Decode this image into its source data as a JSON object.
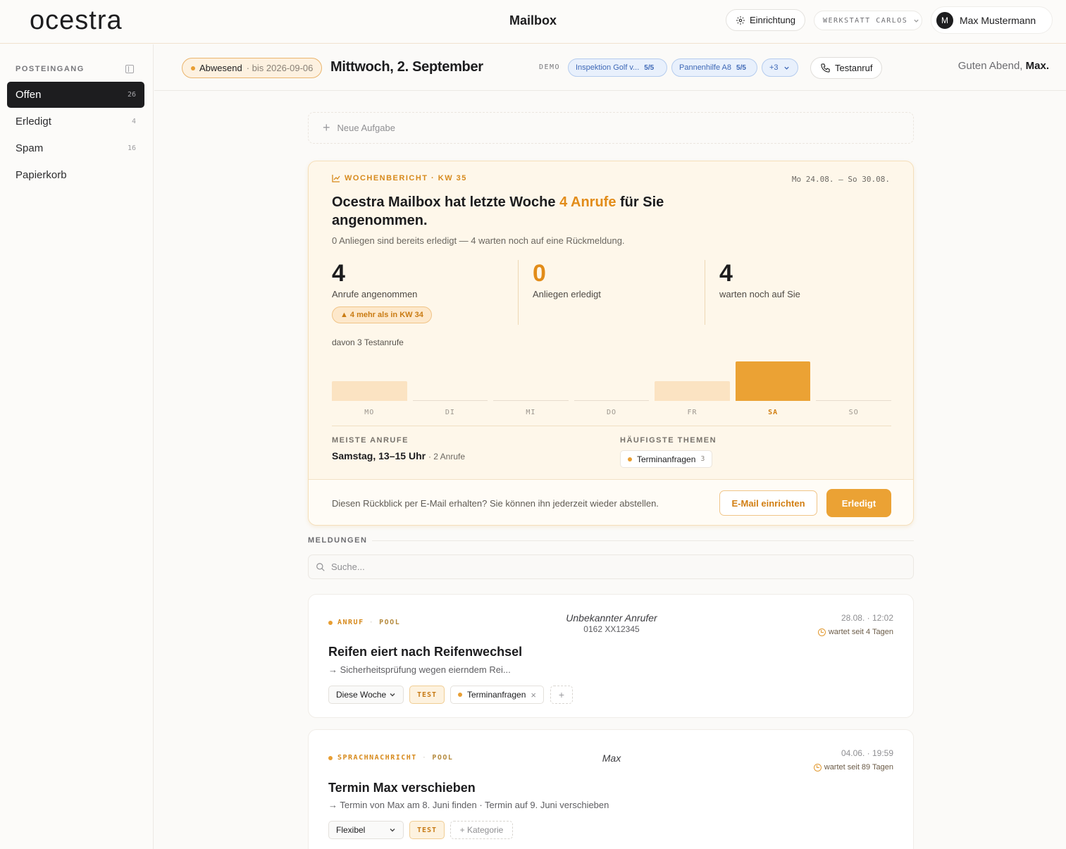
{
  "header": {
    "logo": "ocestra",
    "title": "Mailbox",
    "setup_label": "Einrichtung",
    "workshop": "WERKSTATT CARLOS",
    "user_initial": "M",
    "user_name": "Max Mustermann"
  },
  "sidebar": {
    "heading": "POSTEINGANG",
    "items": [
      {
        "label": "Offen",
        "count": "26"
      },
      {
        "label": "Erledigt",
        "count": "4"
      },
      {
        "label": "Spam",
        "count": "16"
      },
      {
        "label": "Papierkorb",
        "count": ""
      }
    ]
  },
  "subbar": {
    "absent_label": "Abwesend",
    "absent_until": "· bis 2026-09-06",
    "date": "Mittwoch, 2. September",
    "demo_label": "DEMO",
    "demo_chips": [
      {
        "label": "Inspektion Golf v...",
        "score": "5/5"
      },
      {
        "label": "Pannenhilfe A8",
        "score": "5/5"
      }
    ],
    "demo_more": "+3",
    "testcall_label": "Testanruf",
    "greeting_prefix": "Guten Abend,",
    "greeting_name": "Max."
  },
  "new_task": "Neue Aufgabe",
  "report": {
    "kicker": "WOCHENBERICHT · KW 35",
    "range": "Mo 24.08. – So 30.08.",
    "title_pre": "Ocestra Mailbox hat letzte Woche",
    "title_accent": "4 Anrufe",
    "title_post": "für Sie angenommen.",
    "subtitle": "0 Anliegen sind bereits erledigt — 4 warten noch auf eine Rückmeldung.",
    "stats": [
      {
        "value": "4",
        "label": "Anrufe angenommen"
      },
      {
        "value": "0",
        "label": "Anliegen erledigt"
      },
      {
        "value": "4",
        "label": "warten noch auf Sie"
      }
    ],
    "delta": "4 mehr als in KW 34",
    "tests_note": "davon 3 Testanrufe",
    "peak_heading": "MEISTE ANRUFE",
    "peak_value": "Samstag, 13–15 Uhr",
    "peak_detail": "· 2 Anrufe",
    "topics_heading": "HÄUFIGSTE THEMEN",
    "topic_label": "Terminanfragen",
    "topic_count": "3",
    "footer_text": "Diesen Rückblick per E-Mail erhalten? Sie können ihn jederzeit wieder abstellen.",
    "mail_button": "E-Mail einrichten",
    "done_button": "Erledigt"
  },
  "chart_data": {
    "type": "bar",
    "categories": [
      "MO",
      "DI",
      "MI",
      "DO",
      "FR",
      "SA",
      "SO"
    ],
    "values": [
      1,
      0,
      0,
      0,
      1,
      2,
      0
    ],
    "highlight": "SA",
    "colors": {
      "normal": "#fbe3c2",
      "highlight": "#eba234"
    }
  },
  "messages": {
    "heading": "MELDUNGEN",
    "search_placeholder": "Suche...",
    "cards": [
      {
        "type": "ANRUF",
        "pool": "POOL",
        "caller": "Unbekannter Anrufer",
        "caller_number": "0162 XX12345",
        "date": "28.08. · 12:02",
        "waiting": "wartet seit 4 Tagen",
        "title": "Reifen eiert nach Reifenwechsel",
        "summary": "→ Sicherheitsprüfung wegen eierndem Rei...",
        "schedule": "Diese Woche",
        "badge": "TEST",
        "category": "Terminanfragen"
      },
      {
        "type": "SPRACHNACHRICHT",
        "pool": "POOL",
        "caller": "Max",
        "date": "04.06. · 19:59",
        "waiting": "wartet seit 89 Tagen",
        "title": "Termin Max verschieben",
        "summary": "→ Termin von Max am 8. Juni finden · Termin auf 9. Juni verschieben",
        "schedule": "Flexibel",
        "badge": "TEST",
        "add_category": "+ Kategorie"
      }
    ]
  },
  "colors": {
    "accent": "#eba234",
    "demo_blue": "#3e68b6"
  }
}
